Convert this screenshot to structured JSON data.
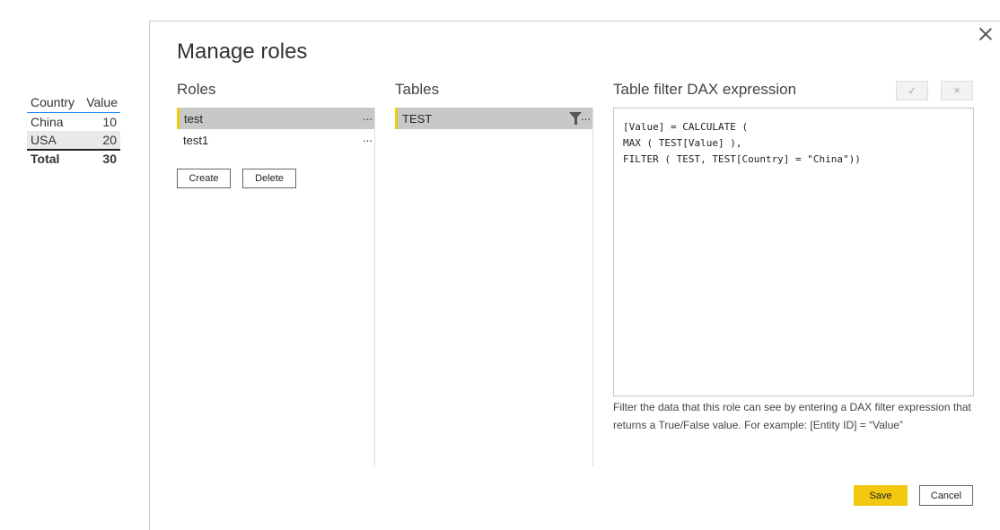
{
  "background_table": {
    "headers": [
      "Country",
      "Value"
    ],
    "rows": [
      {
        "country": "China",
        "value": "10"
      },
      {
        "country": "USA",
        "value": "20"
      }
    ],
    "total": {
      "label": "Total",
      "value": "30"
    }
  },
  "dialog": {
    "title": "Manage roles",
    "roles": {
      "heading": "Roles",
      "items": [
        {
          "label": "test",
          "more": "...",
          "selected": true
        },
        {
          "label": "test1",
          "more": "...",
          "selected": false
        }
      ],
      "create_label": "Create",
      "delete_label": "Delete"
    },
    "tables": {
      "heading": "Tables",
      "items": [
        {
          "label": "TEST",
          "more": "...",
          "icon": "filter-icon",
          "selected": true
        }
      ]
    },
    "dax": {
      "heading": "Table filter DAX expression",
      "apply_symbol": "✓",
      "discard_symbol": "✕",
      "expression": "[Value] = CALCULATE (\nMAX ( TEST[Value] ),\nFILTER ( TEST, TEST[Country] = \"China\"))",
      "hint": "Filter the data that this role can see by entering a DAX filter expression that returns a True/False value. For example: [Entity ID] = “Value”"
    },
    "save_label": "Save",
    "cancel_label": "Cancel"
  },
  "colors": {
    "accent": "#f2c811",
    "selection": "#c8c8c8",
    "table_header_line": "#118dff"
  }
}
